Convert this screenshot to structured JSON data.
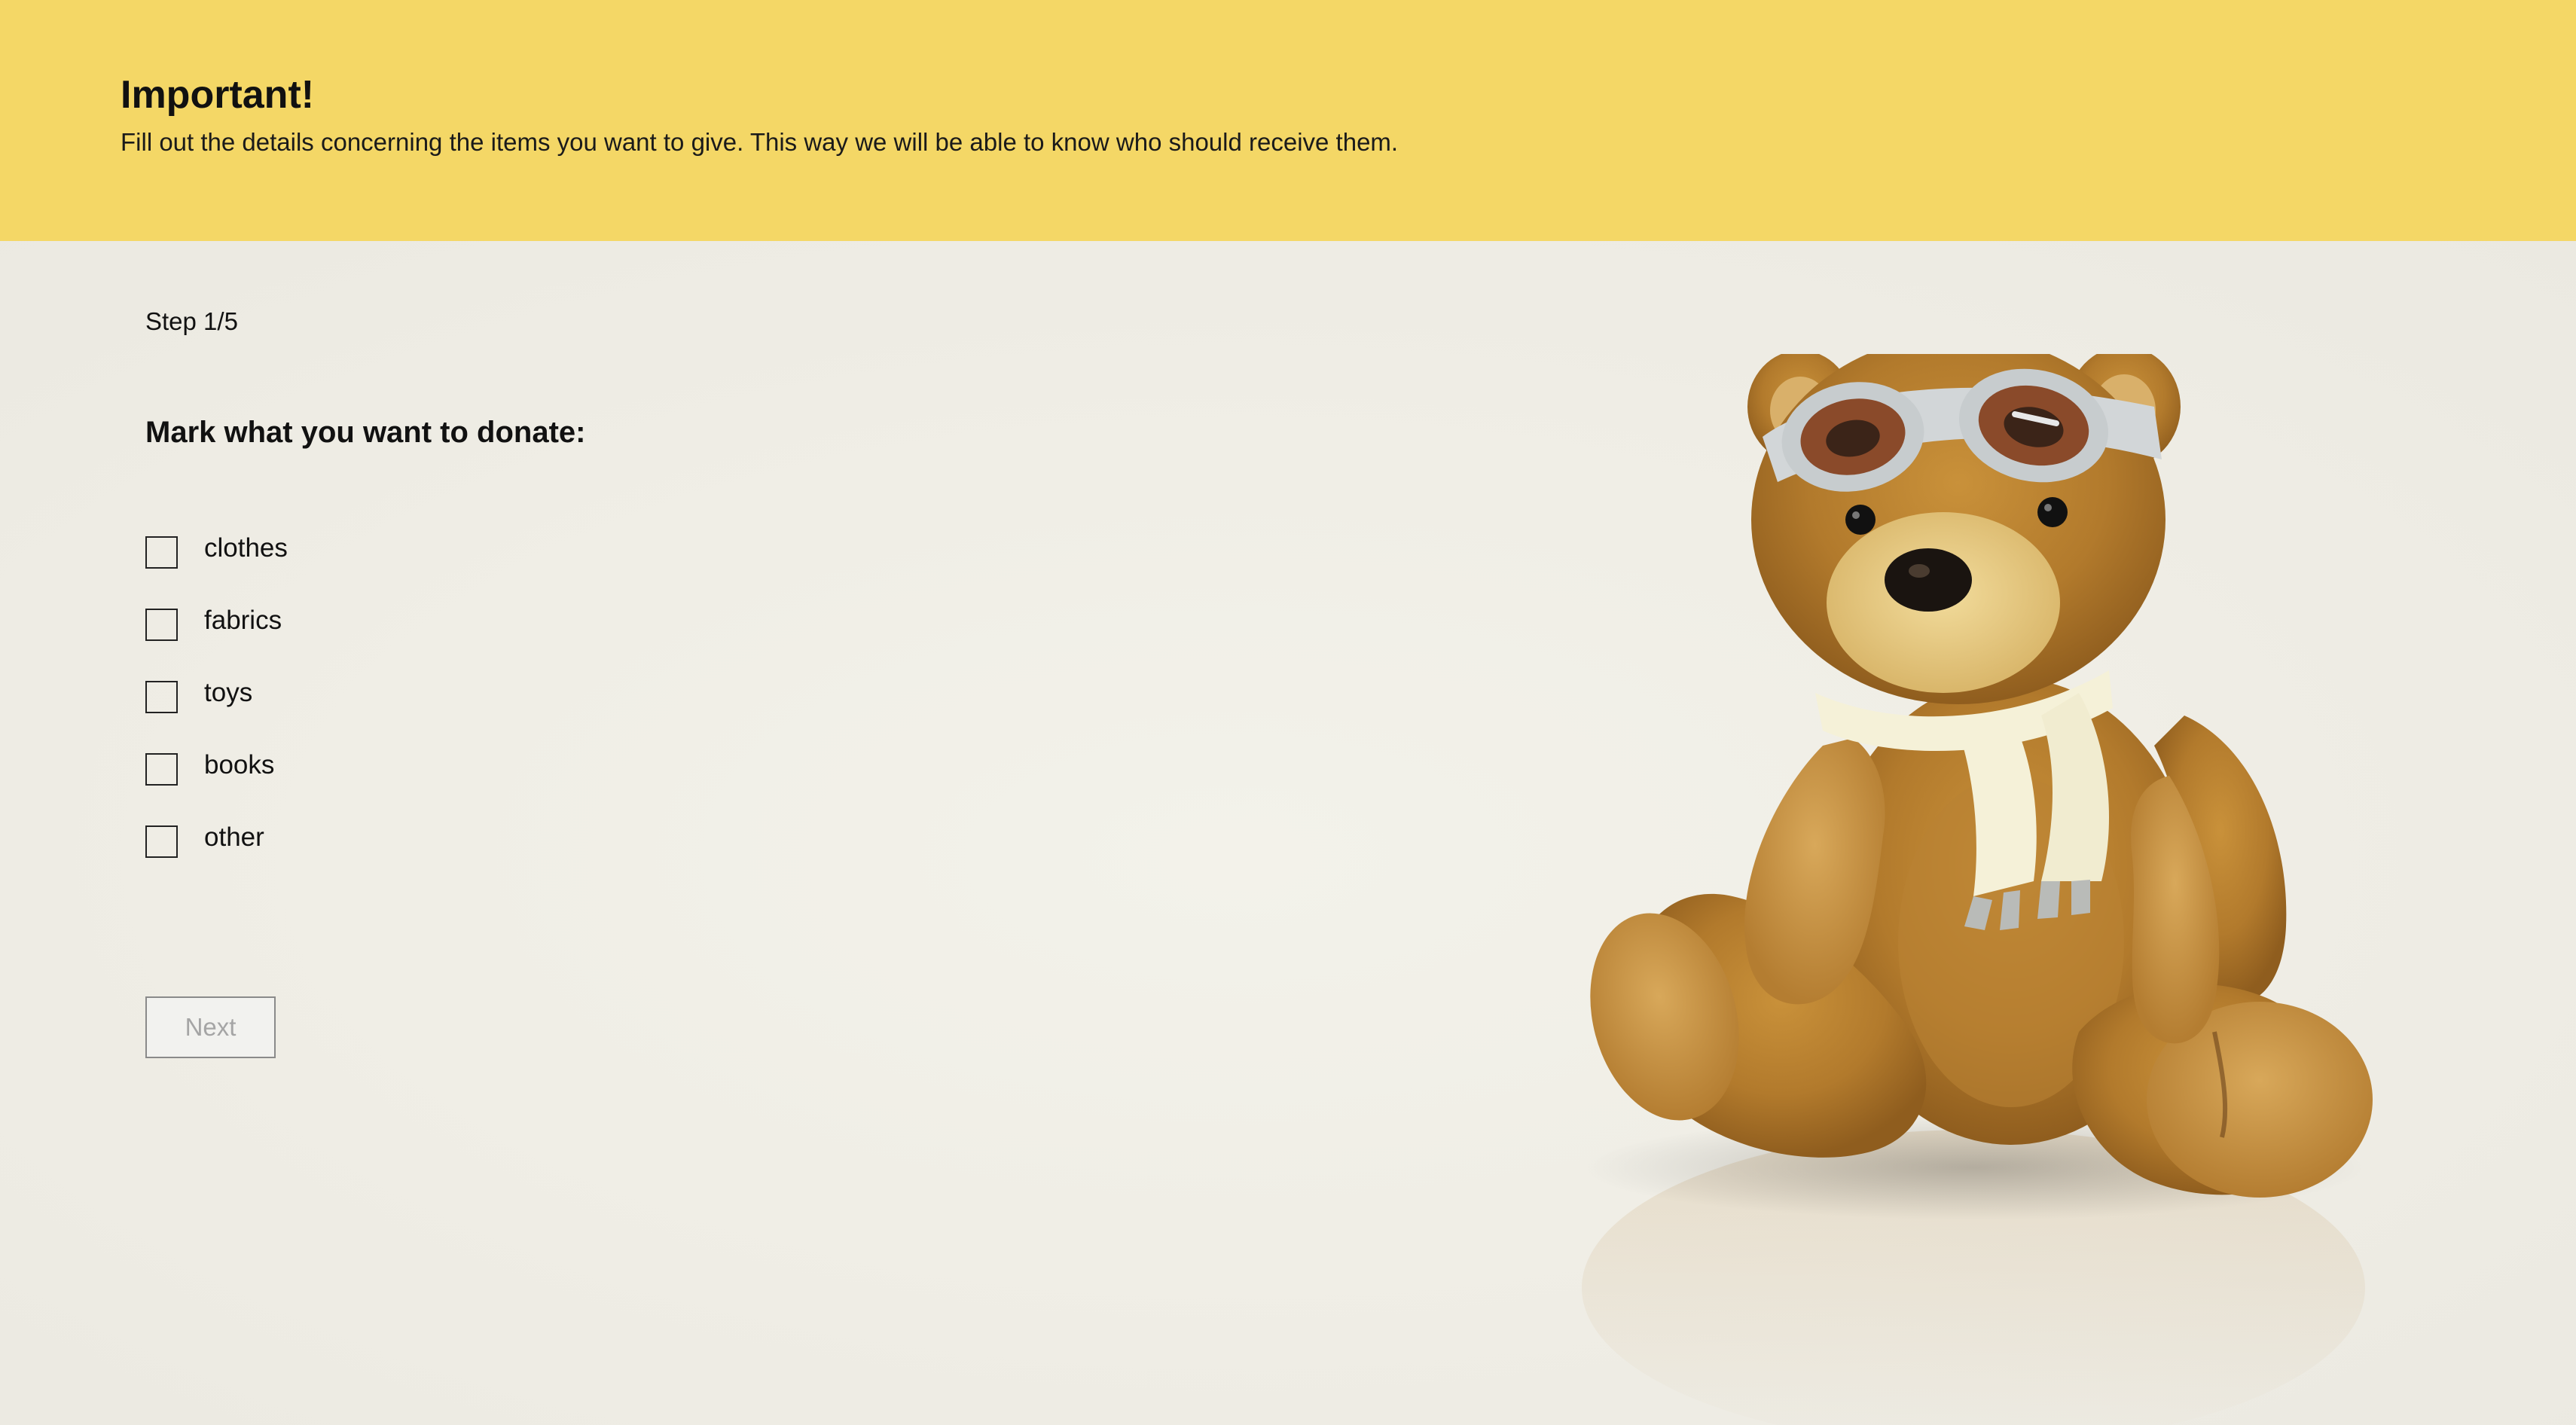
{
  "banner": {
    "title": "Important!",
    "text": "Fill out the details concerning the items you want to give. This way we will be able to know who should receive them."
  },
  "form": {
    "step": "Step 1/5",
    "question": "Mark what you want to donate:",
    "options": [
      {
        "label": "clothes",
        "checked": false
      },
      {
        "label": "fabrics",
        "checked": false
      },
      {
        "label": "toys",
        "checked": false
      },
      {
        "label": "books",
        "checked": false
      },
      {
        "label": "other",
        "checked": false
      }
    ],
    "next_label": "Next",
    "next_enabled": false
  },
  "image": {
    "subject": "teddy-bear-with-goggles-and-scarf"
  },
  "colors": {
    "banner": "#f4d766",
    "background": "#efede6",
    "text": "#111111",
    "button_text_disabled": "#a5a5a5",
    "button_border": "#8a8a8a"
  }
}
